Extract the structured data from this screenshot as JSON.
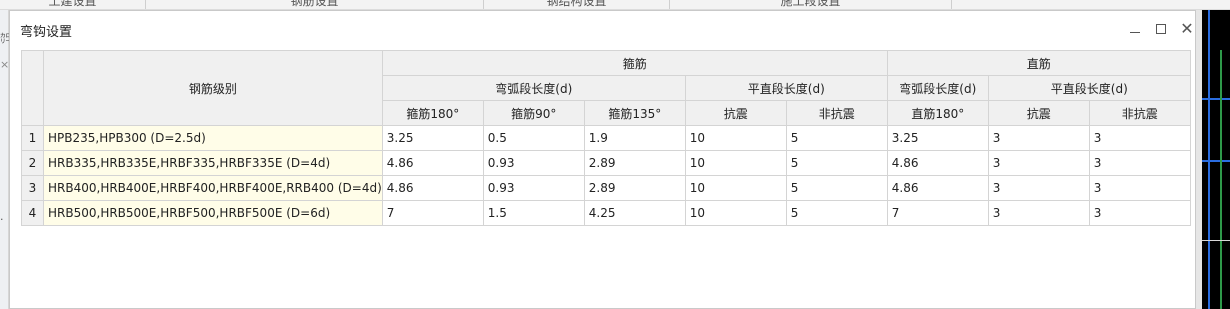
{
  "background": {
    "tabs": [
      "土建设置",
      "钢筋设置",
      "钢结构设置",
      "施工段设置"
    ]
  },
  "dialog": {
    "title": "弯钩设置"
  },
  "table": {
    "grade_header": "钢筋级别",
    "group_stirrup": "箍筋",
    "group_straight": "直筋",
    "sub_arc": "弯弧段长度(d)",
    "sub_flat": "平直段长度(d)",
    "columns": [
      "箍筋180°",
      "箍筋90°",
      "箍筋135°",
      "抗震",
      "非抗震",
      "直筋180°",
      "抗震",
      "非抗震"
    ],
    "rows": [
      {
        "num": "1",
        "grade": "HPB235,HPB300 (D=2.5d)",
        "values": [
          "3.25",
          "0.5",
          "1.9",
          "10",
          "5",
          "3.25",
          "3",
          "3"
        ]
      },
      {
        "num": "2",
        "grade": "HRB335,HRB335E,HRBF335,HRBF335E (D=4d)",
        "values": [
          "4.86",
          "0.93",
          "2.89",
          "10",
          "5",
          "4.86",
          "3",
          "3"
        ]
      },
      {
        "num": "3",
        "grade": "HRB400,HRB400E,HRBF400,HRBF400E,RRB400 (D=4d)",
        "values": [
          "4.86",
          "0.93",
          "2.89",
          "10",
          "5",
          "4.86",
          "3",
          "3"
        ]
      },
      {
        "num": "4",
        "grade": "HRB500,HRB500E,HRBF500,HRBF500E (D=6d)",
        "values": [
          "7",
          "1.5",
          "4.25",
          "10",
          "5",
          "7",
          "3",
          "3"
        ]
      }
    ]
  }
}
